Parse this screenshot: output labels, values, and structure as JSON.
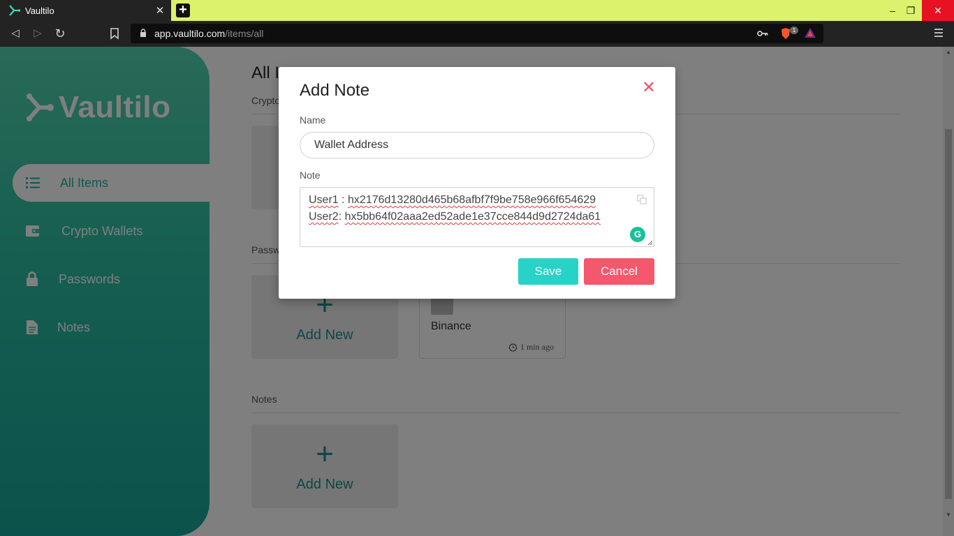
{
  "browser": {
    "tab_title": "Vaultilo",
    "url_host": "app.vaultilo.com",
    "url_path": "/items/all",
    "brave_badge": "1",
    "close_glyph": "✕",
    "newtab_glyph": "+",
    "minimize_glyph": "–",
    "restore_glyph": "❐",
    "back_glyph": "◁",
    "forward_glyph": "▷",
    "reload_glyph": "↻"
  },
  "sidebar": {
    "logo_text": "Vaultilo",
    "items": [
      {
        "label": "All Items",
        "icon": "list-icon",
        "active": true
      },
      {
        "label": "Crypto Wallets",
        "icon": "wallet-icon",
        "active": false
      },
      {
        "label": "Passwords",
        "icon": "lock-icon",
        "active": false
      },
      {
        "label": "Notes",
        "icon": "document-icon",
        "active": false
      }
    ]
  },
  "main": {
    "title": "All Items",
    "sections": {
      "crypto": "Crypto Wallets",
      "passwords": "Passwords",
      "notes": "Notes"
    },
    "add_new_label": "Add New",
    "plus_glyph": "+",
    "password_card": {
      "name": "Binance",
      "time": "1 min ago"
    }
  },
  "modal": {
    "title": "Add Note",
    "close_glyph": "✕",
    "name_label": "Name",
    "name_value": "Wallet Address",
    "note_label": "Note",
    "note_lines": [
      {
        "prefix": "User1",
        "sep": " : ",
        "value": "hx2176d13280d465b68afbf7f9be758e966f654629"
      },
      {
        "prefix": "User2",
        "sep": ": ",
        "value": "hx5bb64f02aaa2ed52ade1e37cce844d9d2724da61"
      }
    ],
    "grammarly_glyph": "G",
    "save_label": "Save",
    "cancel_label": "Cancel"
  },
  "colors": {
    "accent": "#1eb29d",
    "save": "#27d3c7",
    "cancel": "#f5576c",
    "tabbar": "#dcf16c"
  }
}
